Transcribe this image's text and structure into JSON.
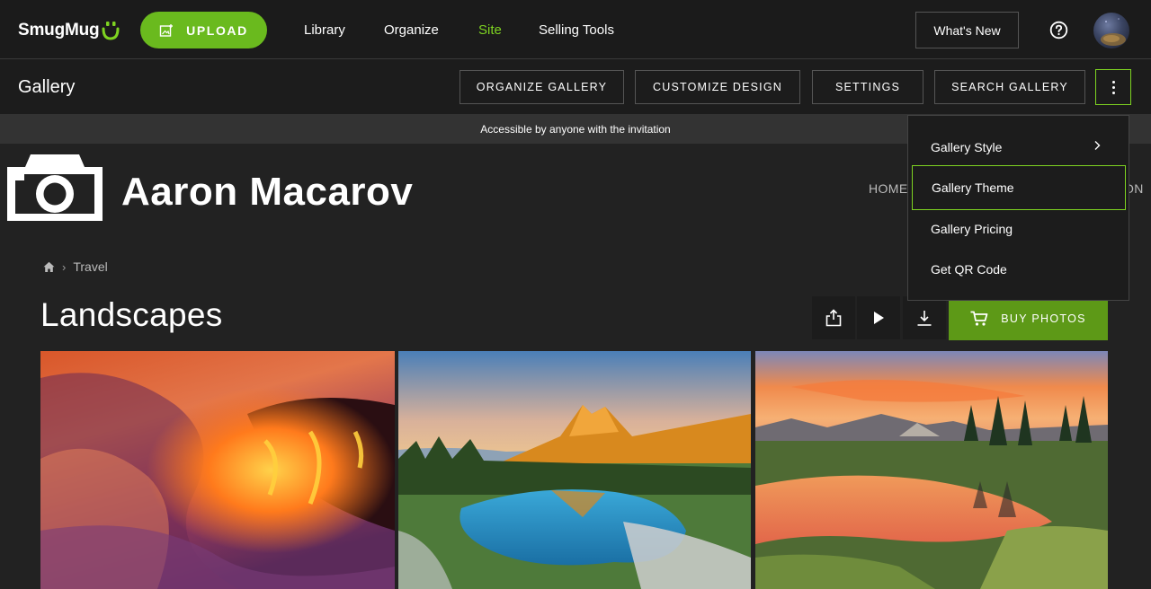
{
  "topnav": {
    "logo_text": "SmugMug",
    "upload_label": "UPLOAD",
    "links": [
      {
        "label": "Library",
        "active": false
      },
      {
        "label": "Organize",
        "active": false
      },
      {
        "label": "Site",
        "active": true
      },
      {
        "label": "Selling Tools",
        "active": false
      }
    ],
    "whats_new_label": "What's New",
    "help_icon": "question-circle-icon",
    "avatar_icon": "user-avatar",
    "accent_color": "#7ed321",
    "upload_color": "#6aba1e"
  },
  "gallerybar": {
    "title": "Gallery",
    "buttons": [
      "ORGANIZE GALLERY",
      "CUSTOMIZE DESIGN",
      "SETTINGS",
      "SEARCH GALLERY"
    ],
    "more_icon": "vertical-ellipsis-icon"
  },
  "banner": {
    "text": "Accessible by anyone with the invitation"
  },
  "site": {
    "name": "Aaron Macarov",
    "logo_icon": "camera-icon",
    "nav_home": "HOME",
    "nav_partial": "ON"
  },
  "breadcrumb": {
    "home_icon": "home-icon",
    "item": "Travel"
  },
  "page": {
    "title": "Landscapes",
    "tools": [
      "share-icon",
      "slideshow-play-icon",
      "download-icon"
    ],
    "buy_label": "BUY PHOTOS",
    "buy_color": "#5d9917"
  },
  "photos": [
    {
      "subject": "lava flowing into ocean"
    },
    {
      "subject": "mountain peak reflected in alpine lake"
    },
    {
      "subject": "sunset meadow pond with pine trees"
    }
  ],
  "menu": {
    "items": [
      {
        "label": "Gallery Style",
        "has_submenu": true,
        "selected": false
      },
      {
        "label": "Gallery Theme",
        "has_submenu": false,
        "selected": true
      },
      {
        "label": "Gallery Pricing",
        "has_submenu": false,
        "selected": false
      },
      {
        "label": "Get QR Code",
        "has_submenu": false,
        "selected": false
      }
    ]
  }
}
